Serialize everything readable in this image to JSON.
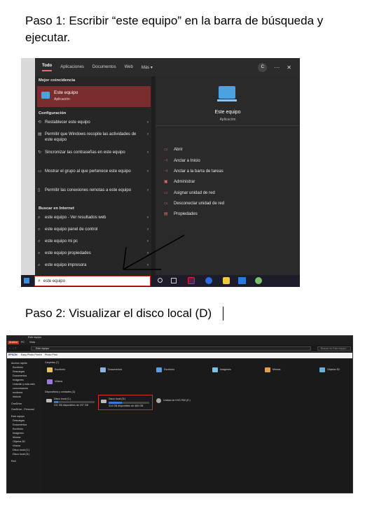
{
  "step1": {
    "heading": "Paso 1:  Escribir “este equipo” en la barra de búsqueda y ejecutar."
  },
  "step2": {
    "heading": "Paso 2: Visualizar el disco local (D)"
  },
  "search": {
    "tabs": [
      "Todo",
      "Aplicaciones",
      "Documentos",
      "Web",
      "Más ▾"
    ],
    "avatar": "C",
    "more": "···",
    "close": "✕",
    "best_match_label": "Mejor coincidencia",
    "best_match": {
      "title": "Este equipo",
      "subtitle": "Aplicación"
    },
    "config_label": "Configuración",
    "config_items": [
      {
        "text": "Restablecer este equipo"
      },
      {
        "text": "Permitir que Windows recopile las actividades de este equipo"
      },
      {
        "text": "Sincronizar las contraseñas en este equipo"
      },
      {
        "text": "Mostrar el grupo al que pertenece este equipo"
      },
      {
        "text": "Permitir las conexiones remotas a este equipo"
      }
    ],
    "web_label": "Buscar en Internet",
    "web_items": [
      {
        "text": "este equipo - Ver resultados web"
      },
      {
        "text": "este equipo panel de control"
      },
      {
        "text": "este equipo mi pc"
      },
      {
        "text": "este equipo propiedades"
      },
      {
        "text": "este equipo impresora"
      }
    ],
    "preview": {
      "title": "Este equipo",
      "subtitle": "Aplicación"
    },
    "actions": [
      "Abrir",
      "Anclar a Inicio",
      "Anclar a la barra de tareas",
      "Administrar",
      "Asignar unidad de red",
      "Desconectar unidad de red",
      "Propiedades"
    ],
    "query": "este equipo"
  },
  "explorer": {
    "title": "Este equipo",
    "ribbon": [
      "Archivo",
      "PC",
      "Vista"
    ],
    "address": "Este equipo",
    "search_placeholder": "Buscar en Este equipo",
    "toolbar": [
      "EPSON",
      "Easy Photo Print ▾",
      "Photo Print"
    ],
    "folders_header": "Carpetas (7)",
    "folders": [
      "Escritorio",
      "Documentos",
      "Escritorio",
      "Imágenes",
      "Música",
      "Objetos 3D",
      "Vídeos"
    ],
    "drives_header": "Dispositivos y unidades (3)",
    "drives": [
      {
        "name": "Disco local (C:)",
        "free": "211 GB disponibles de 237 GB",
        "used": 0.11
      },
      {
        "name": "Disco local (D:)",
        "free": "314 GB disponibles de 465 GB",
        "used": 0.32
      },
      {
        "name": "Unidad de DVD RW (E:)",
        "free": "",
        "used": 0
      }
    ],
    "sidebar": [
      "Acceso rápido",
      "Escritorio",
      "Descargas",
      "Documentos",
      "Imágenes",
      "Linkedin y esta web",
      "comunicación",
      "moderna",
      "historia",
      "OneDrive",
      "OneDrive - Personal",
      "Este equipo",
      "Descargas",
      "Documentos",
      "Escritorio",
      "Imágenes",
      "Música",
      "Objetos 3D",
      "Vídeos",
      "Disco local (C:)",
      "Disco local (D:)",
      "Red"
    ]
  },
  "colors": {
    "highlight": "#d12b2b",
    "accent": "#2d7dd2",
    "best_match_bg": "#7a2d2d"
  }
}
